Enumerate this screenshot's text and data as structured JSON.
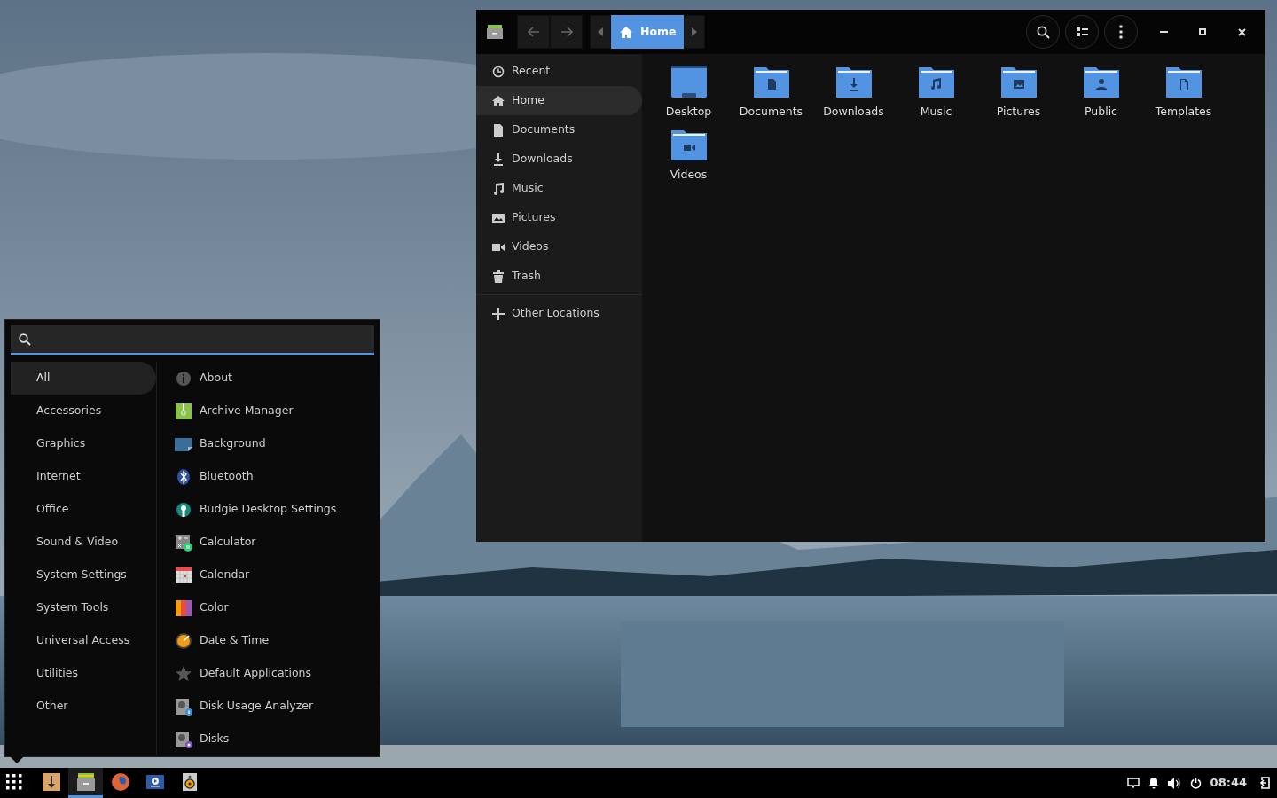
{
  "file_manager": {
    "path_bar": [
      {
        "label": "Home",
        "selected": true
      }
    ],
    "sidebar": {
      "places": [
        {
          "label": "Recent",
          "selected": false
        },
        {
          "label": "Home",
          "selected": true
        },
        {
          "label": "Documents",
          "selected": false
        },
        {
          "label": "Downloads",
          "selected": false
        },
        {
          "label": "Music",
          "selected": false
        },
        {
          "label": "Pictures",
          "selected": false
        },
        {
          "label": "Videos",
          "selected": false
        },
        {
          "label": "Trash",
          "selected": false
        }
      ],
      "other": {
        "label": "Other Locations"
      }
    },
    "folders": [
      {
        "label": "Desktop"
      },
      {
        "label": "Documents"
      },
      {
        "label": "Downloads"
      },
      {
        "label": "Music"
      },
      {
        "label": "Pictures"
      },
      {
        "label": "Public"
      },
      {
        "label": "Templates"
      },
      {
        "label": "Videos"
      }
    ]
  },
  "menu": {
    "categories": [
      {
        "label": "All",
        "selected": true
      },
      {
        "label": "Accessories",
        "selected": false
      },
      {
        "label": "Graphics",
        "selected": false
      },
      {
        "label": "Internet",
        "selected": false
      },
      {
        "label": "Office",
        "selected": false
      },
      {
        "label": "Sound & Video",
        "selected": false
      },
      {
        "label": "System Settings",
        "selected": false
      },
      {
        "label": "System Tools",
        "selected": false
      },
      {
        "label": "Universal Access",
        "selected": false
      },
      {
        "label": "Utilities",
        "selected": false
      },
      {
        "label": "Other",
        "selected": false
      }
    ],
    "apps": [
      {
        "label": "About"
      },
      {
        "label": "Archive Manager"
      },
      {
        "label": "Background"
      },
      {
        "label": "Bluetooth"
      },
      {
        "label": "Budgie Desktop Settings"
      },
      {
        "label": "Calculator"
      },
      {
        "label": "Calendar"
      },
      {
        "label": "Color"
      },
      {
        "label": "Date & Time"
      },
      {
        "label": "Default Applications"
      },
      {
        "label": "Disk Usage Analyzer"
      },
      {
        "label": "Disks"
      }
    ]
  },
  "taskbar": {
    "apps": [
      {
        "selected": false
      },
      {
        "selected": true
      },
      {
        "selected": false
      },
      {
        "selected": false
      },
      {
        "selected": false
      }
    ],
    "clock": "08:44"
  }
}
